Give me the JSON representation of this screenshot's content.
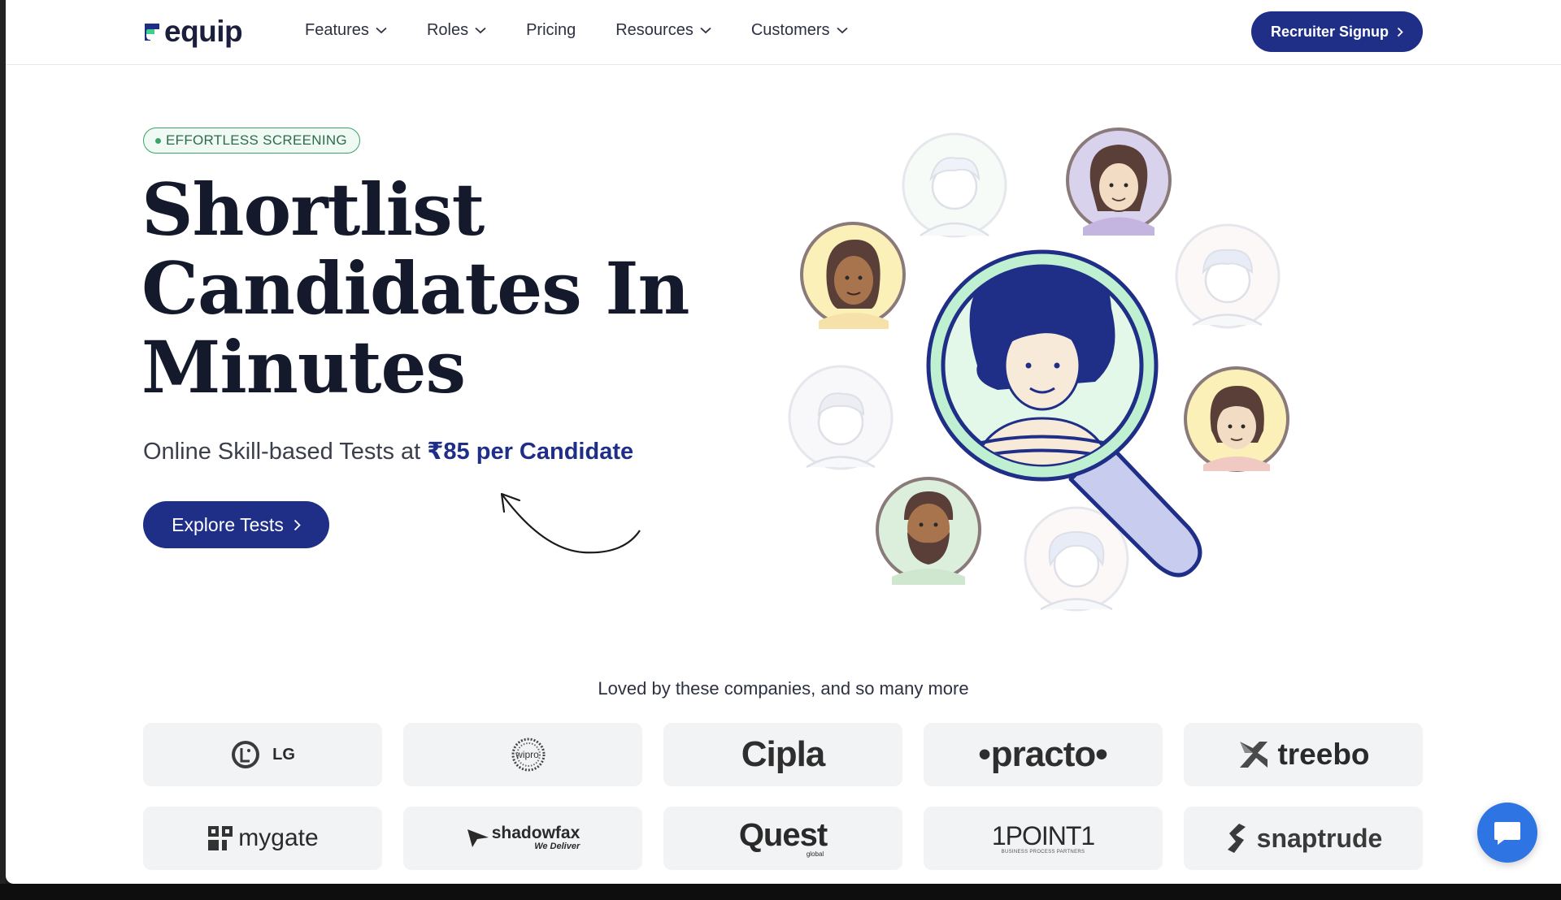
{
  "brand": {
    "name": "equip",
    "color": "#1f2f87",
    "accent_green": "#3aa36a"
  },
  "nav": {
    "items": [
      {
        "label": "Features",
        "has_dropdown": true
      },
      {
        "label": "Roles",
        "has_dropdown": true
      },
      {
        "label": "Pricing",
        "has_dropdown": false
      },
      {
        "label": "Resources",
        "has_dropdown": true
      },
      {
        "label": "Customers",
        "has_dropdown": true
      }
    ],
    "cta_label": "Recruiter Signup"
  },
  "hero": {
    "badge": "EFFORTLESS SCREENING",
    "headline_lines": [
      "Shortlist",
      "Candidates In",
      "Minutes"
    ],
    "subline_prefix": "Online Skill-based Tests at ",
    "subline_price": "₹85 per Candidate",
    "cta_label": "Explore Tests"
  },
  "companies": {
    "heading": "Loved by these companies, and so many more",
    "logos": [
      "LG",
      "wipro",
      "Cipla",
      "practo",
      "treebo",
      "mygate",
      "shadowfax",
      "Quest",
      "1POINT1",
      "snaptrude"
    ],
    "logo_subtexts": {
      "shadowfax": "We Deliver",
      "quest": "global",
      "onepoint": "BUSINESS PROCESS PARTNERS"
    }
  },
  "icons": {
    "chat": "chat-bubble-icon",
    "chevron": "chevron-down-icon",
    "arrow": "chevron-right-icon"
  }
}
